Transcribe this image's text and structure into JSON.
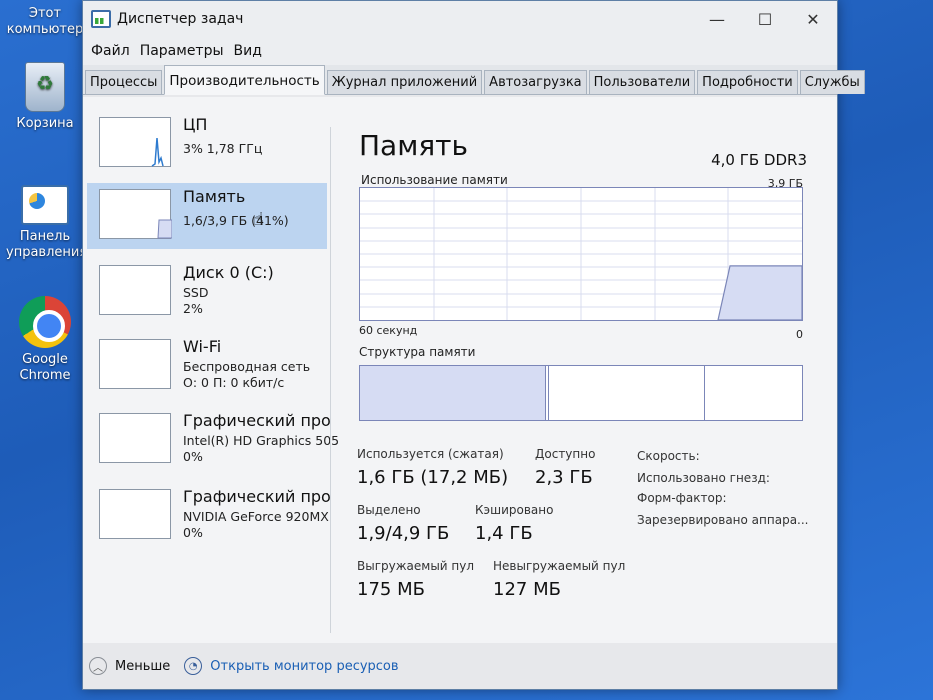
{
  "desktop": {
    "icons": [
      {
        "label": "Этот компьютер"
      },
      {
        "label": "Корзина"
      },
      {
        "label": "Панель управления"
      },
      {
        "label": "Google Chrome"
      }
    ]
  },
  "window": {
    "title": "Диспетчер задач",
    "controls": {
      "minimize": "—",
      "maximize": "☐",
      "close": "✕"
    }
  },
  "menu": [
    "Файл",
    "Параметры",
    "Вид"
  ],
  "tabs": [
    "Процессы",
    "Производительность",
    "Журнал приложений",
    "Автозагрузка",
    "Пользователи",
    "Подробности",
    "Службы"
  ],
  "active_tab": "Производительность",
  "resources": [
    {
      "title": "ЦП",
      "line1": "3% 1,78 ГГц",
      "line2": ""
    },
    {
      "title": "Память",
      "line1": "1,6/3,9 ГБ (41%)",
      "line2": ""
    },
    {
      "title": "Диск 0 (C:)",
      "line1": "SSD",
      "line2": "2%"
    },
    {
      "title": "Wi-Fi",
      "line1": "Беспроводная сеть",
      "line2": "О: 0 П: 0 кбит/с"
    },
    {
      "title": "Графический про",
      "line1": "Intel(R) HD Graphics 505",
      "line2": "0%"
    },
    {
      "title": "Графический про",
      "line1": "NVIDIA GeForce 920MX",
      "line2": "0%"
    }
  ],
  "memory": {
    "title": "Память",
    "type": "4,0 ГБ DDR3",
    "usage_label": "Использование памяти",
    "max_label": "3,9 ГБ",
    "time_label": "60 секунд",
    "zero_label": "0",
    "structure_label": "Структура памяти",
    "usage_level_fraction": 0.41,
    "stats": {
      "in_use_label": "Используется (сжатая)",
      "in_use_value": "1,6 ГБ (17,2 МБ)",
      "available_label": "Доступно",
      "available_value": "2,3 ГБ",
      "committed_label": "Выделено",
      "committed_value": "1,9/4,9 ГБ",
      "cached_label": "Кэшировано",
      "cached_value": "1,4 ГБ",
      "paged_label": "Выгружаемый пул",
      "paged_value": "175 МБ",
      "nonpaged_label": "Невыгружаемый пул",
      "nonpaged_value": "127 МБ",
      "speed_label": "Скорость:",
      "slots_label": "Использовано гнезд:",
      "form_factor_label": "Форм-фактор:",
      "reserved_label": "Зарезервировано аппара..."
    }
  },
  "footer": {
    "less_label": "Меньше",
    "monitor_label": "Открыть монитор ресурсов"
  },
  "colors": {
    "accent": "#1a5fb4",
    "graph_line": "#7b86b8",
    "selected": "#bcd4f0"
  }
}
